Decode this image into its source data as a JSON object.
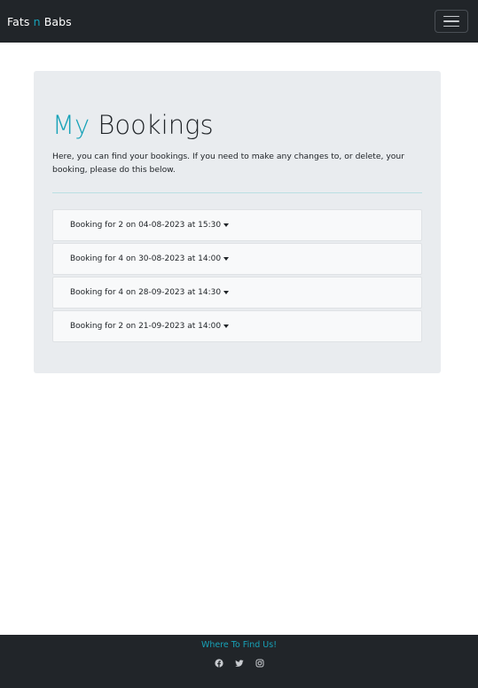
{
  "navbar": {
    "brand_part1": "Fats ",
    "brand_accent": "n",
    "brand_part2": " Babs",
    "toggler_icon": "hamburger-icon"
  },
  "page": {
    "title_accent": "My",
    "title_rest": " Bookings",
    "lead": "Here, you can find your bookings. If you need to make any changes to, or delete, your booking, please do this below."
  },
  "bookings": [
    {
      "label": "Booking for 2 on 04-08-2023 at 15:30"
    },
    {
      "label": "Booking for 4 on 30-08-2023 at 14:00"
    },
    {
      "label": "Booking for 4 on 28-09-2023 at 14:30"
    },
    {
      "label": "Booking for 2 on 21-09-2023 at 14:00"
    }
  ],
  "footer": {
    "title": "Where To Find Us!",
    "socials": [
      "facebook-icon",
      "twitter-icon",
      "instagram-icon"
    ]
  },
  "colors": {
    "accent": "#17a2b8",
    "navbar_bg": "#212529",
    "jumbotron_bg": "#e9ecef"
  }
}
